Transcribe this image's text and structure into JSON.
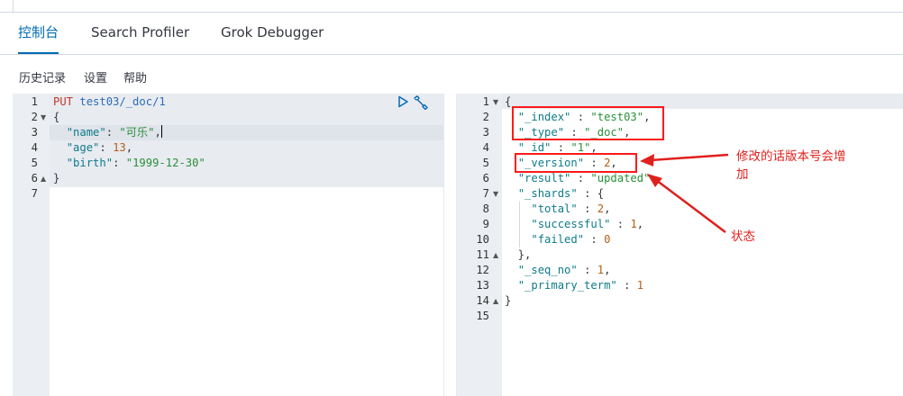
{
  "tabs": [
    "控制台",
    "Search Profiler",
    "Grok Debugger"
  ],
  "menu": [
    "历史记录",
    "设置",
    "帮助"
  ],
  "request": {
    "method": "PUT",
    "path": "test03/_doc/1",
    "body": {
      "name_key": "\"name\"",
      "name_val": "\"可乐\"",
      "age_key": "\"age\"",
      "age_val": "13",
      "birth_key": "\"birth\"",
      "birth_val": "\"1999-12-30\""
    },
    "line_numbers": [
      "1",
      "2",
      "3",
      "4",
      "5",
      "6",
      "7"
    ]
  },
  "response": {
    "index_key": "\"_index\"",
    "index_val": "\"test03\"",
    "type_key": "\"_type\"",
    "type_val": "\"_doc\"",
    "id_key": "\"_id\"",
    "id_val": "\"1\"",
    "version_key": "\"_version\"",
    "version_val": "2",
    "result_key": "\"result\"",
    "result_val": "\"updated\"",
    "shards_key": "\"_shards\"",
    "total_key": "\"total\"",
    "total_val": "2",
    "successful_key": "\"successful\"",
    "successful_val": "1",
    "failed_key": "\"failed\"",
    "failed_val": "0",
    "seq_no_key": "\"_seq_no\"",
    "seq_no_val": "1",
    "primary_term_key": "\"_primary_term\"",
    "primary_term_val": "1",
    "line_numbers": [
      "1",
      "2",
      "3",
      "4",
      "5",
      "6",
      "7",
      "8",
      "9",
      "10",
      "11",
      "12",
      "13",
      "14",
      "15"
    ]
  },
  "annotations": {
    "version_note_line1": "修改的话版本号会增",
    "version_note_line2": "加",
    "status_note": "状态"
  },
  "colors": {
    "accent": "#006bb4",
    "annotation": "#ff1a1a"
  },
  "icons": [
    "run-icon",
    "wrench-icon"
  ]
}
